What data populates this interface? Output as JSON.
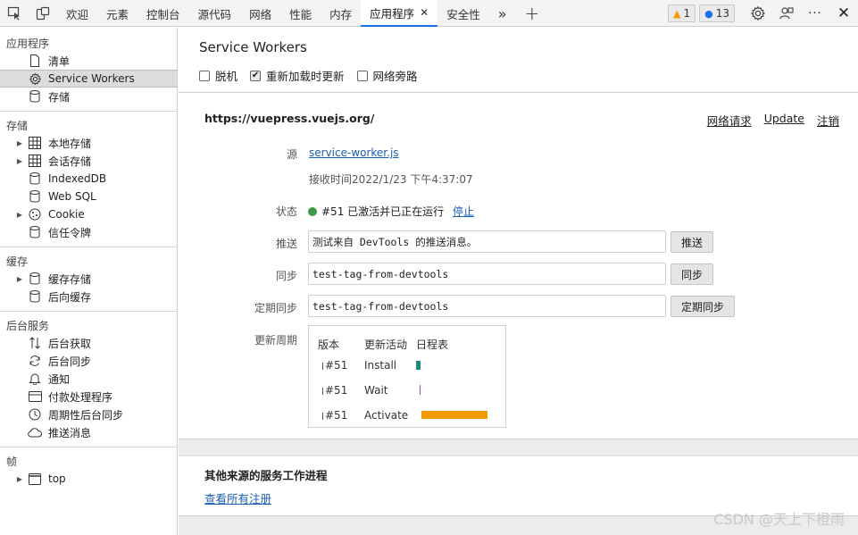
{
  "toolbar": {
    "tabs": [
      "欢迎",
      "元素",
      "控制台",
      "源代码",
      "网络",
      "性能",
      "内存",
      "应用程序",
      "安全性"
    ],
    "active_tab": "应用程序",
    "warnings_count": "1",
    "messages_count": "13",
    "more_tabs": "»",
    "add_tab": "+",
    "close_tab": "✕",
    "close_devtools": "✕",
    "more_menu": "···"
  },
  "sidebar": {
    "app_section": "应用程序",
    "app_items": [
      "清单",
      "Service Workers",
      "存储"
    ],
    "storage_section": "存储",
    "storage_items": [
      "本地存储",
      "会话存储",
      "IndexedDB",
      "Web SQL",
      "Cookie",
      "信任令牌"
    ],
    "cache_section": "缓存",
    "cache_items": [
      "缓存存储",
      "后向缓存"
    ],
    "bg_section": "后台服务",
    "bg_items": [
      "后台获取",
      "后台同步",
      "通知",
      "付款处理程序",
      "周期性后台同步",
      "推送消息"
    ],
    "frames_section": "帧",
    "frames_items": [
      "top"
    ]
  },
  "main": {
    "title": "Service Workers",
    "checkboxes": [
      {
        "label": "脱机",
        "checked": false
      },
      {
        "label": "重新加载时更新",
        "checked": true
      },
      {
        "label": "网络旁路",
        "checked": false
      }
    ],
    "origin": "https://vuepress.vuejs.org/",
    "origin_links": [
      "网络请求",
      "Update",
      "注销"
    ],
    "source_label": "源",
    "source_link": "service-worker.js",
    "received_time": "接收时间2022/1/23 下午4:37:07",
    "status_label": "状态",
    "status_text": "#51 已激活并已正在运行",
    "stop_link": "停止",
    "push_label": "推送",
    "push_value": "测试来自 DevTools 的推送消息。",
    "push_button": "推送",
    "sync_label": "同步",
    "sync_value": "test-tag-from-devtools",
    "sync_button": "同步",
    "periodic_label": "定期同步",
    "periodic_value": "test-tag-from-devtools",
    "periodic_button": "定期同步",
    "cycle_label": "更新周期",
    "cycle_headers": [
      "版本",
      "更新活动",
      "日程表"
    ],
    "cycle_rows": [
      {
        "version": "#51",
        "activity": "Install",
        "color": "#1a8a7a"
      },
      {
        "version": "#51",
        "activity": "Wait",
        "color": "#9b4fb5"
      },
      {
        "version": "#51",
        "activity": "Activate",
        "color": "#f29900"
      }
    ],
    "other_title": "其他来源的服务工作进程",
    "other_link": "查看所有注册"
  },
  "watermark": "CSDN @天上下橙雨"
}
